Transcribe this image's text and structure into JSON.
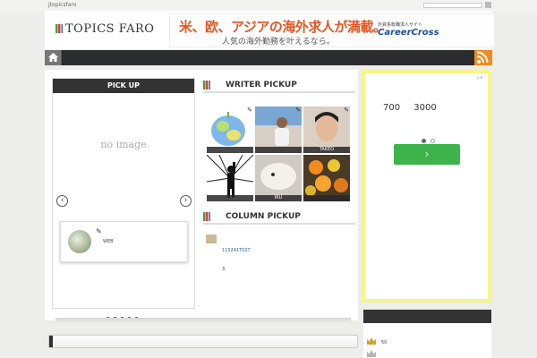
{
  "topbar": {
    "site_name": "jtopicsfaro"
  },
  "header": {
    "logo_text": "TOPICS FARO",
    "banner": {
      "headline": "米、欧、アジアの海外求人が満載。",
      "subline": "人気の海外勤務を叶えるなら。",
      "small_text": "外資系転職求人サイト",
      "brand": "CareerCross"
    }
  },
  "nav": {
    "home_icon": "home-icon",
    "rss_icon": "rss-icon"
  },
  "pickup": {
    "title": "PICK UP",
    "placeholder": "no image",
    "card_label": "WEB",
    "slide_count": 5
  },
  "writer_pickup": {
    "title": "WRITER PICKUP",
    "thumbs": [
      {
        "caption": ""
      },
      {
        "caption": ""
      },
      {
        "caption": "TAKEO"
      },
      {
        "caption": ""
      },
      {
        "caption": "IRU"
      },
      {
        "caption": ""
      }
    ]
  },
  "column_pickup": {
    "title": "COLUMN PICKUP",
    "items": [
      {
        "text": "115241TSST"
      },
      {
        "text": "3"
      }
    ]
  },
  "ad": {
    "numbers": "700 3000",
    "button_glyph": "›"
  },
  "ranking": {
    "rows": [
      {
        "value": "50"
      },
      {
        "value": ""
      }
    ]
  },
  "colors": {
    "nav_bg": "#2b2c2d",
    "rss": "#f08b1d",
    "ad_border": "#f5f58a",
    "ad_button": "#3cb44b"
  }
}
